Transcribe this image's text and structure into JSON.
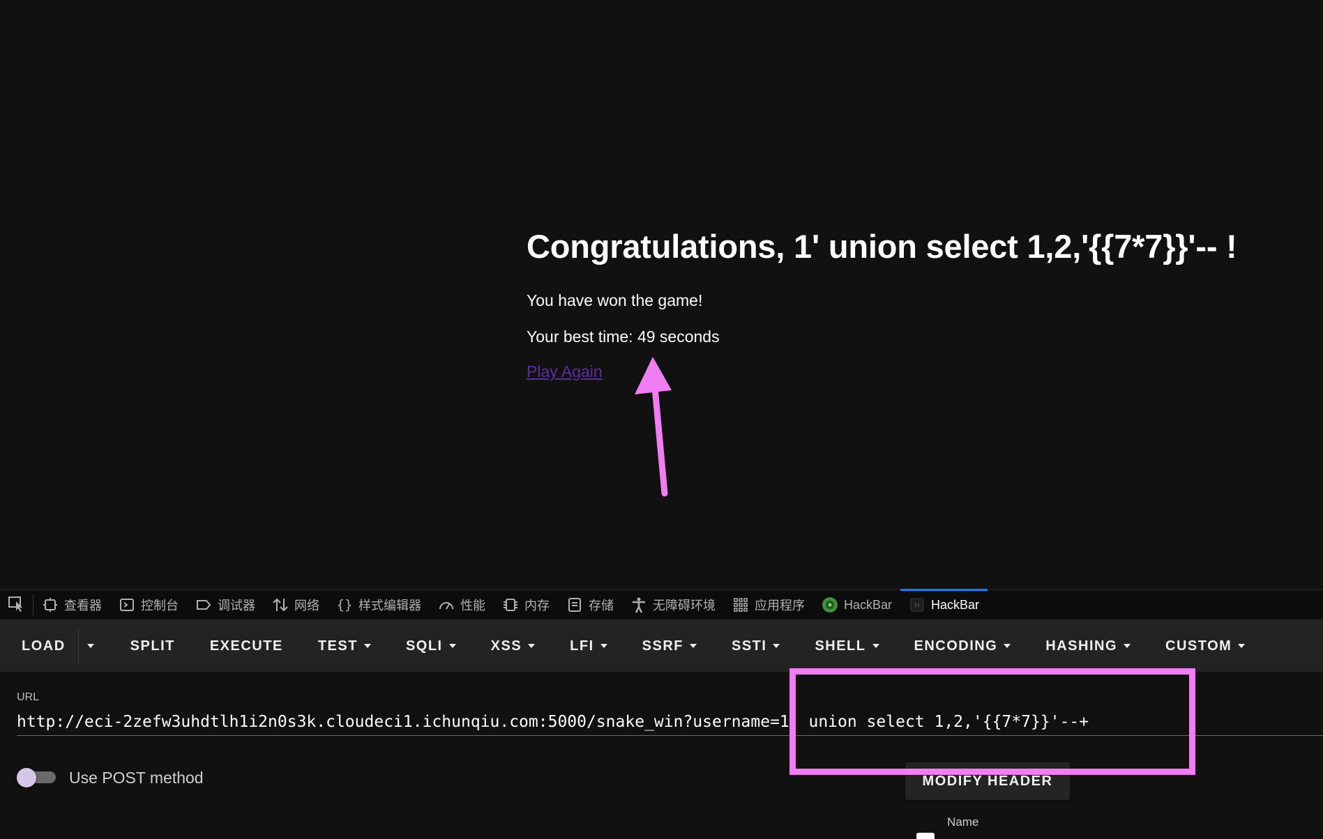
{
  "content": {
    "heading": "Congratulations, 1' union select 1,2,'{{7*7}}'-- !",
    "won_text": "You have won the game!",
    "best_time_text": "Your best time: 49 seconds",
    "play_again_label": "Play Again"
  },
  "devtools": {
    "tabs": [
      {
        "label": "查看器",
        "icon": "inspector-icon"
      },
      {
        "label": "控制台",
        "icon": "console-icon"
      },
      {
        "label": "调试器",
        "icon": "debugger-icon"
      },
      {
        "label": "网络",
        "icon": "network-icon"
      },
      {
        "label": "样式编辑器",
        "icon": "style-editor-icon"
      },
      {
        "label": "性能",
        "icon": "performance-icon"
      },
      {
        "label": "内存",
        "icon": "memory-icon"
      },
      {
        "label": "存储",
        "icon": "storage-icon"
      },
      {
        "label": "无障碍环境",
        "icon": "accessibility-icon"
      },
      {
        "label": "应用程序",
        "icon": "application-icon"
      },
      {
        "label": "HackBar",
        "icon": "hackbar-green-icon"
      },
      {
        "label": "HackBar",
        "icon": "hackbar-dark-icon",
        "active": true
      }
    ]
  },
  "hackbar": {
    "toolbar": {
      "load": "LOAD",
      "split": "SPLIT",
      "execute": "EXECUTE",
      "test": "TEST",
      "sqli": "SQLI",
      "xss": "XSS",
      "lfi": "LFI",
      "ssrf": "SSRF",
      "ssti": "SSTI",
      "shell": "SHELL",
      "encoding": "ENCODING",
      "hashing": "HASHING",
      "custom": "CUSTOM"
    },
    "url_label": "URL",
    "url_value": "http://eci-2zefw3uhdtlh1i2n0s3k.cloudeci1.ichunqiu.com:5000/snake_win?username=1' union select 1,2,'{{7*7}}'--+",
    "post_method_label": "Use POST method",
    "post_method_enabled": false,
    "modify_header_label": "MODIFY HEADER",
    "name_label": "Name"
  },
  "colors": {
    "annotation": "#f07ef2",
    "active_tab_accent": "#0a84ff",
    "link": "#5a2e9e"
  }
}
